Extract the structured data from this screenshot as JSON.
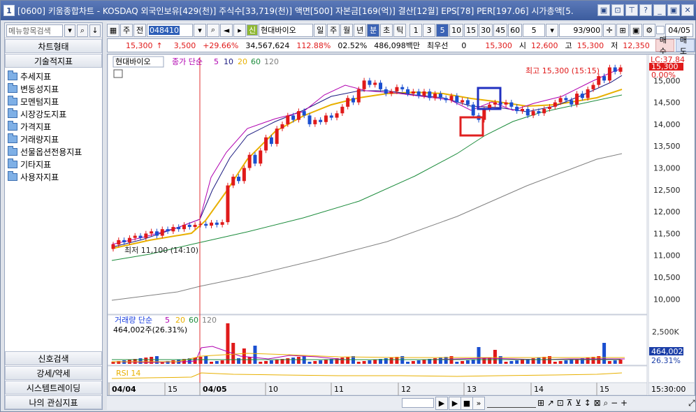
{
  "window": {
    "number": "1",
    "title": "[0600] 키움종합차트 - KOSDAQ 외국인보유[429(천)] 주식수[33,719(천)] 액면[500] 자본금[169(억)] 결산[12월] EPS[78] PER[197.06] 시가총액[5.",
    "buttons": [
      "▣",
      "⊡",
      "⊤",
      "?",
      "_",
      "▣",
      "✕"
    ]
  },
  "left_panel": {
    "search_placeholder": "메뉴항목검색",
    "header1": "차트형태",
    "header2": "기술적지표",
    "tree": [
      "추세지표",
      "변동성지표",
      "모멘텀지표",
      "시장강도지표",
      "가격지표",
      "거래량지표",
      "선물옵션전용지표",
      "기타지표",
      "사용자지표"
    ],
    "bottom": [
      "신호검색",
      "강세/약세",
      "시스템트레이딩",
      "나의 관심지표"
    ]
  },
  "toolbar": {
    "type1": "주",
    "type2": "전",
    "code": "048410",
    "name": "현대바이오",
    "name_badge": "신",
    "periods": [
      "일",
      "주",
      "월",
      "년",
      "분",
      "초",
      "틱"
    ],
    "selected_period": "분",
    "intervals": [
      "1",
      "3",
      "5",
      "10",
      "15",
      "30",
      "45",
      "60"
    ],
    "selected_interval": "5",
    "count_value": "5",
    "range": "93/900",
    "date": "04/05"
  },
  "pricebar": {
    "price": "15,300",
    "change": "3,500",
    "change_pct": "+29.66%",
    "volume": "34,567,624",
    "vol_ratio": "112.88%",
    "turnover": "02.52%",
    "amount": "486,098백만",
    "pref": "최우선",
    "pref_val": "0",
    "current": "15,300",
    "open_label": "시",
    "open": "12,600",
    "high_label": "고",
    "high": "15,300",
    "low_label": "저",
    "low": "12,350",
    "buy": "매수",
    "sell": "매도"
  },
  "chart_labels": {
    "stock": "현대바이오",
    "ma_legend_prefix": "종가 단순",
    "ma_periods": [
      "5",
      "10",
      "20",
      "60",
      "120"
    ],
    "ma_colors": [
      "#b000b0",
      "#1a1a80",
      "#e8b000",
      "#1c8c3c",
      "#808080"
    ],
    "high_note": "최고 15,300 (15:15)",
    "low_note": "최저 11,100 (14:10)",
    "lc": "LC:37.84",
    "price_tag": "15,300",
    "pct_tag": "0.00%",
    "volume_legend_prefix": "거래량 단순",
    "volume_ma": [
      "5",
      "20",
      "60",
      "120"
    ],
    "volume_value": "464,002주(26.31%)",
    "volume_tag": "464,002",
    "volume_pct_tag": "26.31%",
    "volume_axis": "2,500K",
    "rsi_label": "RSI 14",
    "x_labels": [
      {
        "t": "04/04",
        "bold": true
      },
      {
        "t": "15",
        "bold": false
      },
      {
        "t": "04/05",
        "bold": true
      },
      {
        "t": "10",
        "bold": false
      },
      {
        "t": "11",
        "bold": false
      },
      {
        "t": "12",
        "bold": false
      },
      {
        "t": "13",
        "bold": false
      },
      {
        "t": "14",
        "bold": false
      },
      {
        "t": "15",
        "bold": false
      }
    ],
    "time_label": "15:30:00"
  },
  "chart_data": {
    "type": "candlestick",
    "ylim": [
      9750,
      15500
    ],
    "yticks": [
      "15,000",
      "14,500",
      "14,000",
      "13,500",
      "13,000",
      "12,500",
      "12,000",
      "11,500",
      "11,000",
      "10,500",
      "10,000"
    ],
    "ytick_values": [
      15000,
      14500,
      14000,
      13500,
      13000,
      12500,
      12000,
      11500,
      11000,
      10500,
      10000
    ]
  }
}
